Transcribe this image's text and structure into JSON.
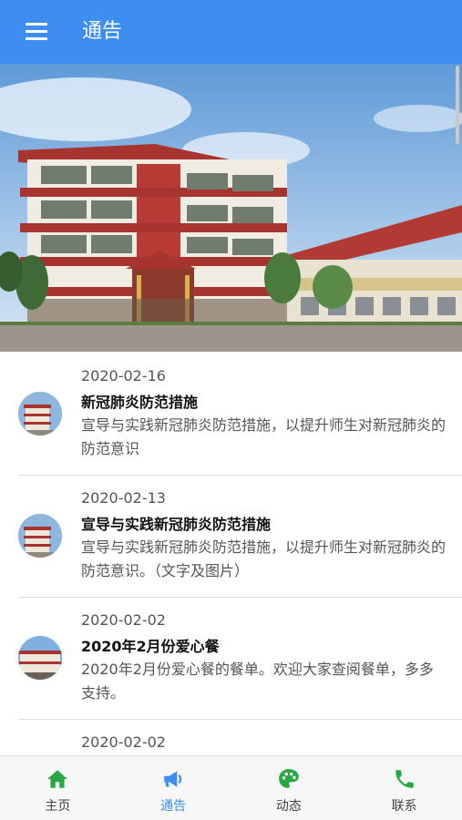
{
  "header": {
    "title": "通告",
    "menu_icon": "menu-icon"
  },
  "notices": [
    {
      "date": "2020-02-16",
      "title": "新冠肺炎防范措施",
      "summary": "宣导与实践新冠肺炎防范措施，以提升师生对新冠肺炎的防范意识"
    },
    {
      "date": "2020-02-13",
      "title": "宣导与实践新冠肺炎防范措施",
      "summary": "宣导与实践新冠肺炎防范措施，以提升师生对新冠肺炎的防范意识。（文字及图片）"
    },
    {
      "date": "2020-02-02",
      "title": "2020年2月份爱心餐",
      "summary": "2020年2月份爱心餐的餐单。欢迎大家查阅餐单，多多支持。"
    },
    {
      "date": "2020-02-02",
      "title": "",
      "summary": ""
    }
  ],
  "bottom_nav": [
    {
      "label": "主页",
      "icon": "home-icon",
      "color": "#27a844"
    },
    {
      "label": "通告",
      "icon": "megaphone-icon",
      "color": "#3d8ef0",
      "active": true
    },
    {
      "label": "动态",
      "icon": "palette-icon",
      "color": "#27a844"
    },
    {
      "label": "联系",
      "icon": "phone-icon",
      "color": "#27a844"
    }
  ],
  "colors": {
    "appbar": "#3d8ef0",
    "nav_active": "#3d8ef0",
    "nav_icon": "#27a844"
  }
}
